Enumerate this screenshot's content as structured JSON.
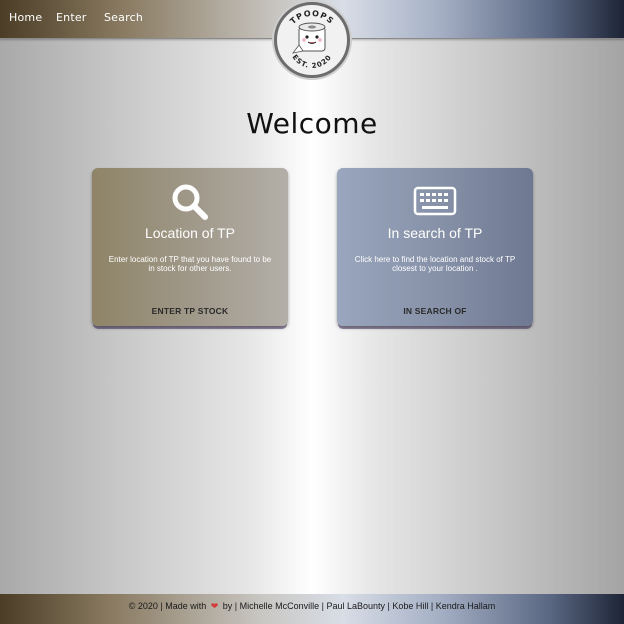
{
  "nav": {
    "links": [
      "Home",
      "Enter",
      "Search"
    ]
  },
  "logo": {
    "top_text": "TPOOPS",
    "bottom_text": "EST. 2020"
  },
  "page_title": "Welcome",
  "cards": [
    {
      "title": "Location of TP",
      "description": "Enter location of TP that you have found to be in stock for other users.",
      "action": "ENTER TP STOCK",
      "icon": "search-icon"
    },
    {
      "title": "In search of TP",
      "description": "Click here to find the location and stock of TP closest to your location .",
      "action": "IN SEARCH OF",
      "icon": "keyboard-icon"
    }
  ],
  "footer": {
    "prefix": "© 2020 | Made with",
    "suffix": "by | Michelle McConville | Paul LaBounty | Kobe Hill | Kendra Hallam",
    "heart": "❤"
  },
  "colors": {
    "heart": "#d43a3a",
    "card_left": "#a19a8c",
    "card_right": "#8590a7"
  }
}
